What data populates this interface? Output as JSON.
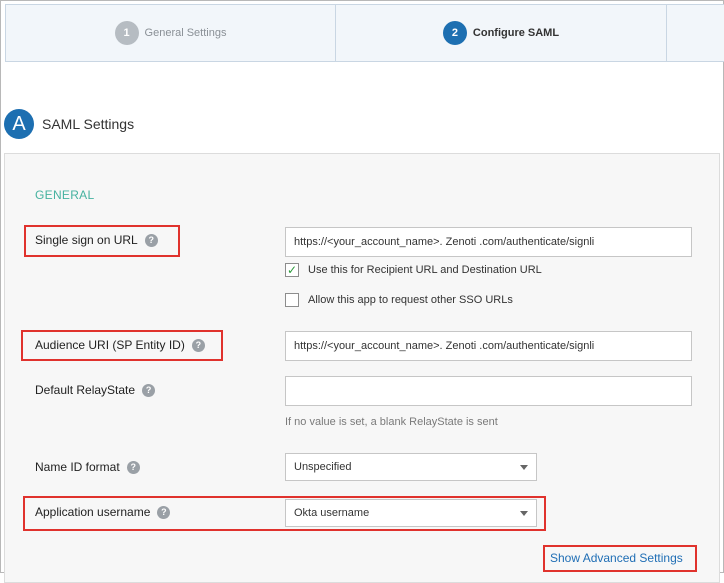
{
  "stepper": {
    "steps": [
      {
        "num": "1",
        "label": "General Settings"
      },
      {
        "num": "2",
        "label": "Configure SAML"
      }
    ]
  },
  "section": {
    "letter": "A",
    "title": "SAML Settings"
  },
  "general_label": "GENERAL",
  "fields": {
    "sso_url": {
      "label": "Single sign on URL",
      "value": "https://<your_account_name>. Zenoti .com/authenticate/signli"
    },
    "recipient_checkbox": {
      "label": "Use this for Recipient URL and Destination URL",
      "checked": true
    },
    "allow_sso_checkbox": {
      "label": "Allow this app to request other SSO URLs",
      "checked": false
    },
    "audience_uri": {
      "label": "Audience URI (SP Entity ID)",
      "value": "https://<your_account_name>. Zenoti .com/authenticate/signli"
    },
    "relay_state": {
      "label": "Default RelayState",
      "value": "",
      "hint": "If no value is set, a blank RelayState is sent"
    },
    "name_id_format": {
      "label": "Name ID format",
      "value": "Unspecified"
    },
    "app_username": {
      "label": "Application username",
      "value": "Okta username"
    }
  },
  "advanced_link": "Show Advanced Settings",
  "help_glyph": "?",
  "check_glyph": "✓",
  "colors": {
    "accent": "#1d6fb1",
    "highlight": "#e0322d",
    "general": "#46b2a0"
  }
}
